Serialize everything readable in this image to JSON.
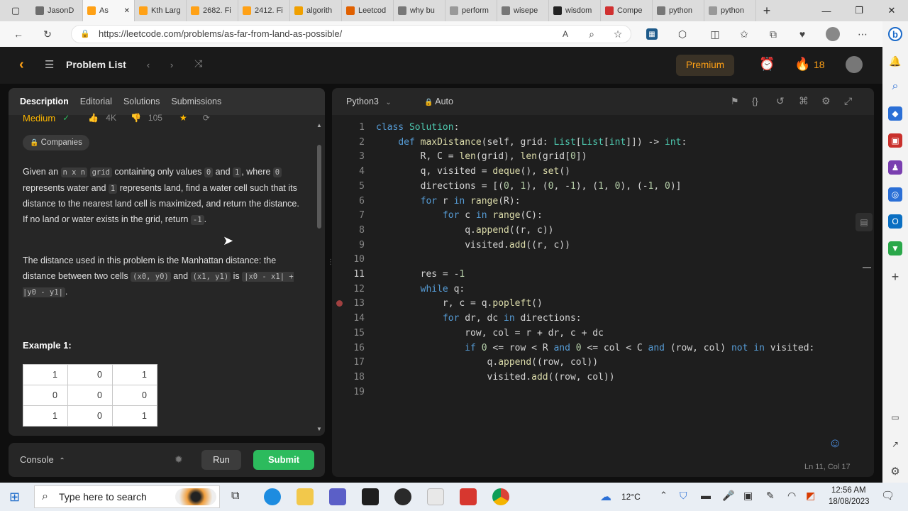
{
  "browser": {
    "tabs": [
      {
        "label": "JasonD",
        "color": "#6d6d6d"
      },
      {
        "label": "As",
        "color": "#ffa116",
        "active": true
      },
      {
        "label": "Kth Larg",
        "color": "#ffa116"
      },
      {
        "label": "2682. Fi",
        "color": "#ffa116"
      },
      {
        "label": "2412. Fi",
        "color": "#ffa116"
      },
      {
        "label": "algorith",
        "color": "#f0a000"
      },
      {
        "label": "Leetcod",
        "color": "#e06000"
      },
      {
        "label": "why bu",
        "color": "#777777"
      },
      {
        "label": "perform",
        "color": "#999999"
      },
      {
        "label": "wisepe",
        "color": "#777777"
      },
      {
        "label": "wisdom",
        "color": "#222222"
      },
      {
        "label": "Compe",
        "color": "#d03030"
      },
      {
        "label": "python",
        "color": "#777777"
      },
      {
        "label": "python",
        "color": "#999999"
      }
    ],
    "url": "https://leetcode.com/problems/as-far-from-land-as-possible/"
  },
  "header": {
    "problem_list": "Problem List",
    "premium": "Premium",
    "streak": "18"
  },
  "left": {
    "tabs": [
      "Description",
      "Editorial",
      "Solutions",
      "Submissions"
    ],
    "difficulty": "Medium",
    "likes": "4K",
    "dislikes": "105",
    "companies": "Companies",
    "p1": {
      "a": "Given an ",
      "c1": "n x n",
      "b": " ",
      "c2": "grid",
      "d": " containing only values ",
      "c3": "0",
      "e": " and ",
      "c4": "1",
      "f": ", where ",
      "c5": "0",
      "g": " represents water and ",
      "c6": "1",
      "h": " represents land, find a water cell such that its distance to the nearest land cell is maximized, and return the distance. If no land or water exists in the grid, return ",
      "c7": "-1",
      "i": "."
    },
    "p2": {
      "a": "The distance used in this problem is the Manhattan distance: the distance between two cells ",
      "c1": "(x0, y0)",
      "b": " and ",
      "c2": "(x1, y1)",
      "c": " is ",
      "c3": "|x0 - x1| + |y0 - y1|",
      "d": "."
    },
    "example_title": "Example 1:",
    "grid": [
      [
        1,
        0,
        1
      ],
      [
        0,
        0,
        0
      ],
      [
        1,
        0,
        1
      ]
    ]
  },
  "console": {
    "label": "Console",
    "run": "Run",
    "submit": "Submit"
  },
  "editor": {
    "language": "Python3",
    "mode": "Auto",
    "status": "Ln 11, Col 17",
    "lines": [
      "class Solution:",
      "    def maxDistance(self, grid: List[List[int]]) -> int:",
      "        R, C = len(grid), len(grid[0])",
      "        q, visited = deque(), set()",
      "        directions = [(0, 1), (0, -1), (1, 0), (-1, 0)]",
      "        for r in range(R):",
      "            for c in range(C):",
      "                q.append((r, c))",
      "                visited.add((r, c))",
      "",
      "        res = -1",
      "        while q:",
      "            r, c = q.popleft()",
      "            for dr, dc in directions:",
      "                row, col = r + dr, c + dc",
      "                if 0 <= row < R and 0 <= col < C and (row, col) not in visited:",
      "                    q.append((row, col))",
      "                    visited.add((row, col))",
      ""
    ]
  },
  "taskbar": {
    "search_placeholder": "Type here to search",
    "temperature": "12°C",
    "time": "12:56 AM",
    "date": "18/08/2023"
  }
}
